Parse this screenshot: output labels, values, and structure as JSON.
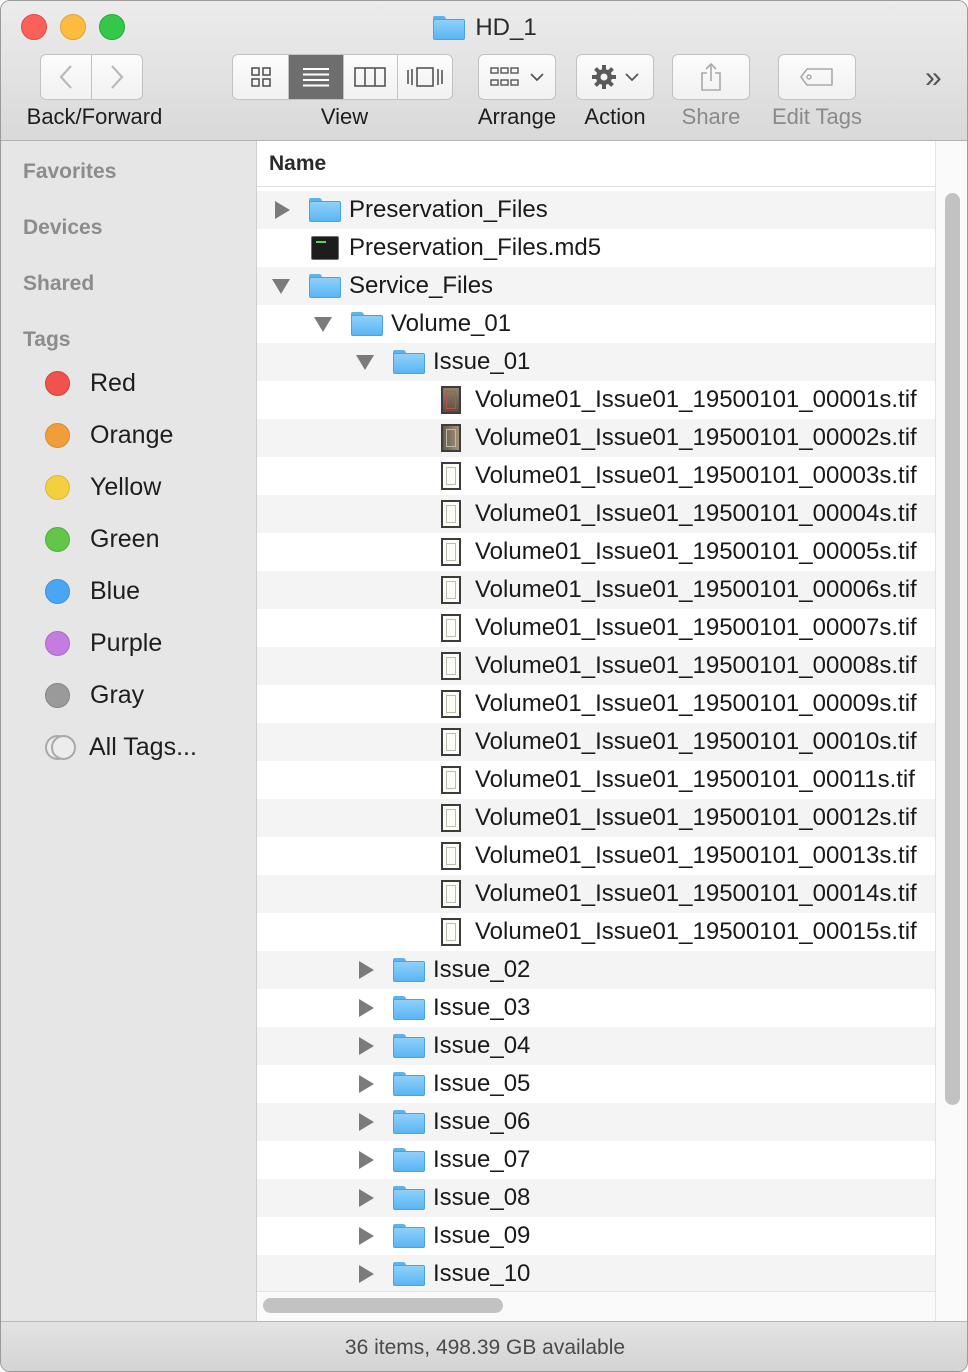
{
  "window": {
    "title": "HD_1"
  },
  "toolbar": {
    "back_forward_label": "Back/Forward",
    "view_label": "View",
    "arrange_label": "Arrange",
    "action_label": "Action",
    "share_label": "Share",
    "edit_tags_label": "Edit Tags",
    "overflow_glyph": "»"
  },
  "sidebar": {
    "headings": [
      "Favorites",
      "Devices",
      "Shared",
      "Tags"
    ],
    "tags": [
      {
        "label": "Red",
        "color": "#f0524c"
      },
      {
        "label": "Orange",
        "color": "#f19d3a"
      },
      {
        "label": "Yellow",
        "color": "#f4cf3f"
      },
      {
        "label": "Green",
        "color": "#64c54b"
      },
      {
        "label": "Blue",
        "color": "#4aa6f3"
      },
      {
        "label": "Purple",
        "color": "#c47ce0"
      },
      {
        "label": "Gray",
        "color": "#9a9a9a"
      },
      {
        "label": "All Tags..."
      }
    ]
  },
  "list": {
    "column_name": "Name",
    "rows": [
      "Preservation_Files",
      "Preservation_Files.md5",
      "Service_Files",
      "Volume_01",
      "Issue_01",
      "Volume01_Issue01_19500101_00001s.tif",
      "Volume01_Issue01_19500101_00002s.tif",
      "Volume01_Issue01_19500101_00003s.tif",
      "Volume01_Issue01_19500101_00004s.tif",
      "Volume01_Issue01_19500101_00005s.tif",
      "Volume01_Issue01_19500101_00006s.tif",
      "Volume01_Issue01_19500101_00007s.tif",
      "Volume01_Issue01_19500101_00008s.tif",
      "Volume01_Issue01_19500101_00009s.tif",
      "Volume01_Issue01_19500101_00010s.tif",
      "Volume01_Issue01_19500101_00011s.tif",
      "Volume01_Issue01_19500101_00012s.tif",
      "Volume01_Issue01_19500101_00013s.tif",
      "Volume01_Issue01_19500101_00014s.tif",
      "Volume01_Issue01_19500101_00015s.tif",
      "Issue_02",
      "Issue_03",
      "Issue_04",
      "Issue_05",
      "Issue_06",
      "Issue_07",
      "Issue_08",
      "Issue_09",
      "Issue_10"
    ]
  },
  "status": {
    "text": "36 items, 498.39 GB available"
  }
}
